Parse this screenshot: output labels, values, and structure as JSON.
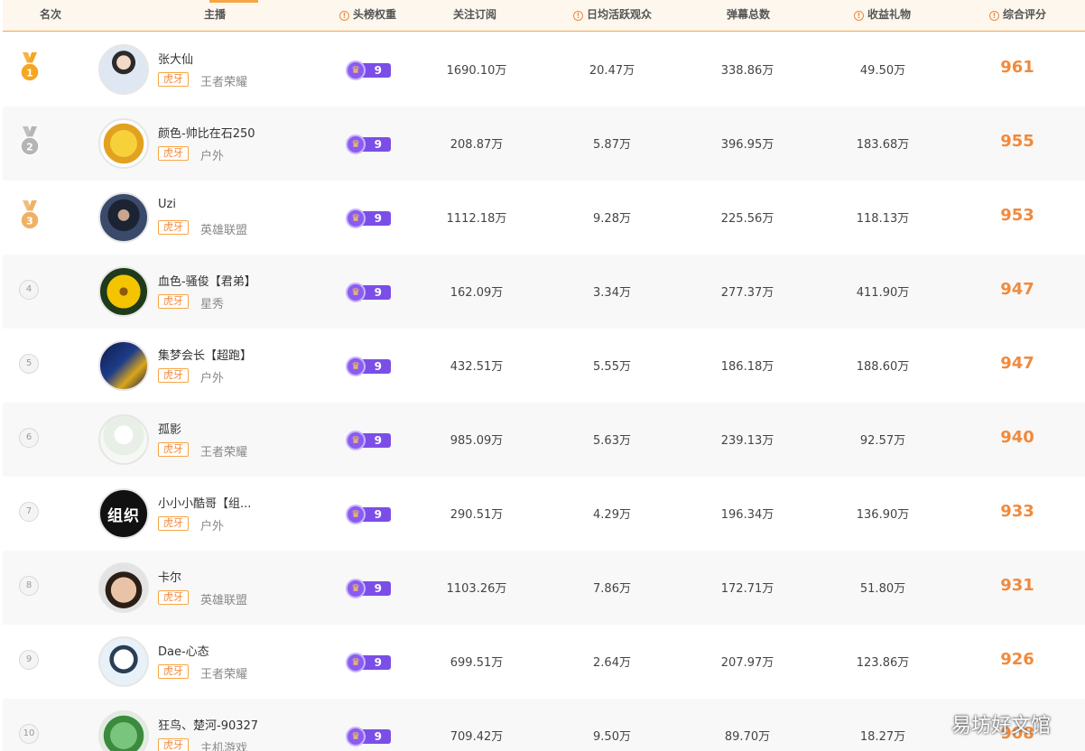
{
  "header": {
    "rank": "名次",
    "anchor": "主播",
    "weight": "头榜权重",
    "followers": "关注订阅",
    "daily_active": "日均活跃观众",
    "danmaku": "弹幕总数",
    "gifts": "收益礼物",
    "score": "综合评分"
  },
  "rows": [
    {
      "rank": "1",
      "name": "张大仙",
      "platform": "虎牙",
      "category": "王者荣耀",
      "weight": "9",
      "followers": "1690.10万",
      "daily_active": "20.47万",
      "danmaku": "338.86万",
      "gifts": "49.50万",
      "score": "961",
      "medal": "gold"
    },
    {
      "rank": "2",
      "name": "颜色-帅比在石250",
      "platform": "虎牙",
      "category": "户外",
      "weight": "9",
      "followers": "208.87万",
      "daily_active": "5.87万",
      "danmaku": "396.95万",
      "gifts": "183.68万",
      "score": "955",
      "medal": "silver"
    },
    {
      "rank": "3",
      "name": "Uzi",
      "platform": "虎牙",
      "category": "英雄联盟",
      "weight": "9",
      "followers": "1112.18万",
      "daily_active": "9.28万",
      "danmaku": "225.56万",
      "gifts": "118.13万",
      "score": "953",
      "medal": "bronze"
    },
    {
      "rank": "4",
      "name": "血色-骚俊【君弟】",
      "platform": "虎牙",
      "category": "星秀",
      "weight": "9",
      "followers": "162.09万",
      "daily_active": "3.34万",
      "danmaku": "277.37万",
      "gifts": "411.90万",
      "score": "947"
    },
    {
      "rank": "5",
      "name": "集梦会长【超跑】",
      "platform": "虎牙",
      "category": "户外",
      "weight": "9",
      "followers": "432.51万",
      "daily_active": "5.55万",
      "danmaku": "186.18万",
      "gifts": "188.60万",
      "score": "947"
    },
    {
      "rank": "6",
      "name": "孤影",
      "platform": "虎牙",
      "category": "王者荣耀",
      "weight": "9",
      "followers": "985.09万",
      "daily_active": "5.63万",
      "danmaku": "239.13万",
      "gifts": "92.57万",
      "score": "940"
    },
    {
      "rank": "7",
      "name": "小小小酷哥【组...",
      "platform": "虎牙",
      "category": "户外",
      "weight": "9",
      "followers": "290.51万",
      "daily_active": "4.29万",
      "danmaku": "196.34万",
      "gifts": "136.90万",
      "score": "933"
    },
    {
      "rank": "8",
      "name": "卡尔",
      "platform": "虎牙",
      "category": "英雄联盟",
      "weight": "9",
      "followers": "1103.26万",
      "daily_active": "7.86万",
      "danmaku": "172.71万",
      "gifts": "51.80万",
      "score": "931"
    },
    {
      "rank": "9",
      "name": "Dae-心态",
      "platform": "虎牙",
      "category": "王者荣耀",
      "weight": "9",
      "followers": "699.51万",
      "daily_active": "2.64万",
      "danmaku": "207.97万",
      "gifts": "123.86万",
      "score": "926"
    },
    {
      "rank": "10",
      "name": "狂鸟、楚河-90327",
      "platform": "虎牙",
      "category": "主机游戏",
      "weight": "9",
      "followers": "709.42万",
      "daily_active": "9.50万",
      "danmaku": "89.70万",
      "gifts": "18.27万",
      "score": "908"
    }
  ],
  "avatar_text": {
    "row7": "组织"
  },
  "watermark": "易坊好文馆",
  "colors": {
    "accent": "#f08a3c",
    "header_line": "#f7a545",
    "badge": "#7b4ee8",
    "gold": "#f5a623",
    "silver": "#b5b5b5",
    "bronze": "#f0b165"
  }
}
